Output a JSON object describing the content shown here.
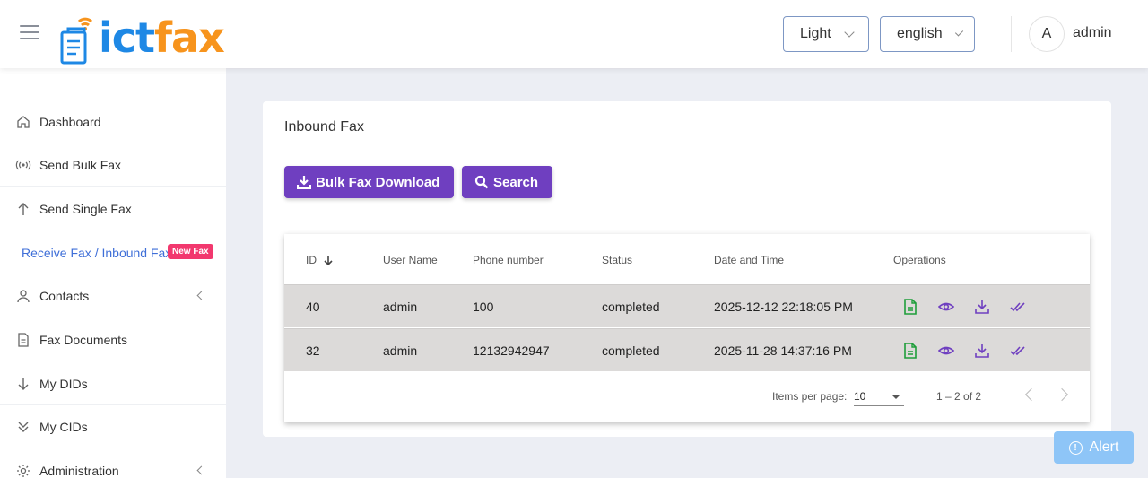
{
  "header": {
    "logo": {
      "part1": "ict",
      "part2": "fax"
    },
    "theme_select": "Light",
    "language_select": "english",
    "avatar_initial": "A",
    "user_name": "admin"
  },
  "sidebar": {
    "items": [
      {
        "label": "Dashboard",
        "icon": "home-icon"
      },
      {
        "label": "Send Bulk Fax",
        "icon": "broadcast-icon"
      },
      {
        "label": "Send Single Fax",
        "icon": "arrow-up-icon"
      },
      {
        "label": "Receive Fax / Inbound Fax",
        "icon": "",
        "active": true,
        "badge": "New Fax"
      },
      {
        "label": "Contacts",
        "icon": "user-icon",
        "has_submenu": true
      },
      {
        "label": "Fax Documents",
        "icon": "document-icon"
      },
      {
        "label": "My DIDs",
        "icon": "arrow-down-icon"
      },
      {
        "label": "My CIDs",
        "icon": "double-chevron-down-icon"
      },
      {
        "label": "Administration",
        "icon": "gear-icon",
        "has_submenu": true
      }
    ]
  },
  "main": {
    "title": "Inbound Fax",
    "buttons": {
      "bulk_download": "Bulk Fax Download",
      "search": "Search"
    },
    "table": {
      "columns": [
        "ID",
        "User Name",
        "Phone number",
        "Status",
        "Date and Time",
        "Operations"
      ],
      "rows": [
        {
          "id": "40",
          "user": "admin",
          "phone": "100",
          "status": "completed",
          "datetime": "2025-12-12 22:18:05 PM"
        },
        {
          "id": "32",
          "user": "admin",
          "phone": "12132942947",
          "status": "completed",
          "datetime": "2025-11-28 14:37:16 PM"
        }
      ]
    },
    "pager": {
      "items_per_page_label": "Items per page:",
      "page_size": "10",
      "range": "1 – 2 of 2"
    }
  },
  "alert_button": "Alert",
  "colors": {
    "primary": "#6f3fc0",
    "active_link": "#3f6fd8",
    "badge": "#f2386e",
    "pdf_icon": "#1e9e3a",
    "alert": "#8ec5f7"
  }
}
